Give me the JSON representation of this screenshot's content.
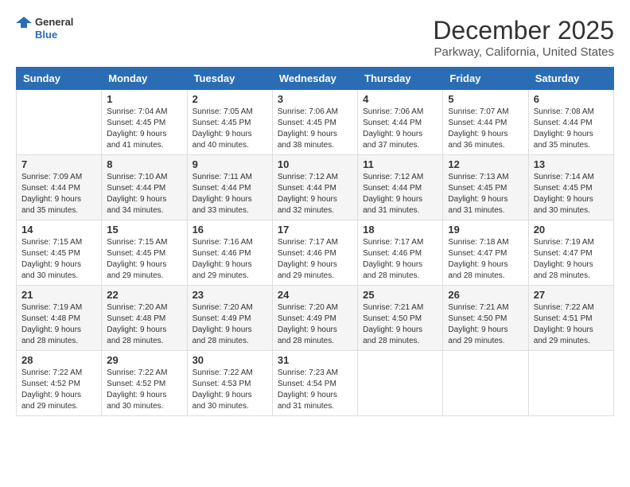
{
  "logo": {
    "general": "General",
    "blue": "Blue"
  },
  "title": "December 2025",
  "location": "Parkway, California, United States",
  "days_of_week": [
    "Sunday",
    "Monday",
    "Tuesday",
    "Wednesday",
    "Thursday",
    "Friday",
    "Saturday"
  ],
  "weeks": [
    [
      {
        "day": "",
        "sunrise": "",
        "sunset": "",
        "daylight": ""
      },
      {
        "day": "1",
        "sunrise": "Sunrise: 7:04 AM",
        "sunset": "Sunset: 4:45 PM",
        "daylight": "Daylight: 9 hours and 41 minutes."
      },
      {
        "day": "2",
        "sunrise": "Sunrise: 7:05 AM",
        "sunset": "Sunset: 4:45 PM",
        "daylight": "Daylight: 9 hours and 40 minutes."
      },
      {
        "day": "3",
        "sunrise": "Sunrise: 7:06 AM",
        "sunset": "Sunset: 4:45 PM",
        "daylight": "Daylight: 9 hours and 38 minutes."
      },
      {
        "day": "4",
        "sunrise": "Sunrise: 7:06 AM",
        "sunset": "Sunset: 4:44 PM",
        "daylight": "Daylight: 9 hours and 37 minutes."
      },
      {
        "day": "5",
        "sunrise": "Sunrise: 7:07 AM",
        "sunset": "Sunset: 4:44 PM",
        "daylight": "Daylight: 9 hours and 36 minutes."
      },
      {
        "day": "6",
        "sunrise": "Sunrise: 7:08 AM",
        "sunset": "Sunset: 4:44 PM",
        "daylight": "Daylight: 9 hours and 35 minutes."
      }
    ],
    [
      {
        "day": "7",
        "sunrise": "Sunrise: 7:09 AM",
        "sunset": "Sunset: 4:44 PM",
        "daylight": "Daylight: 9 hours and 35 minutes."
      },
      {
        "day": "8",
        "sunrise": "Sunrise: 7:10 AM",
        "sunset": "Sunset: 4:44 PM",
        "daylight": "Daylight: 9 hours and 34 minutes."
      },
      {
        "day": "9",
        "sunrise": "Sunrise: 7:11 AM",
        "sunset": "Sunset: 4:44 PM",
        "daylight": "Daylight: 9 hours and 33 minutes."
      },
      {
        "day": "10",
        "sunrise": "Sunrise: 7:12 AM",
        "sunset": "Sunset: 4:44 PM",
        "daylight": "Daylight: 9 hours and 32 minutes."
      },
      {
        "day": "11",
        "sunrise": "Sunrise: 7:12 AM",
        "sunset": "Sunset: 4:44 PM",
        "daylight": "Daylight: 9 hours and 31 minutes."
      },
      {
        "day": "12",
        "sunrise": "Sunrise: 7:13 AM",
        "sunset": "Sunset: 4:45 PM",
        "daylight": "Daylight: 9 hours and 31 minutes."
      },
      {
        "day": "13",
        "sunrise": "Sunrise: 7:14 AM",
        "sunset": "Sunset: 4:45 PM",
        "daylight": "Daylight: 9 hours and 30 minutes."
      }
    ],
    [
      {
        "day": "14",
        "sunrise": "Sunrise: 7:15 AM",
        "sunset": "Sunset: 4:45 PM",
        "daylight": "Daylight: 9 hours and 30 minutes."
      },
      {
        "day": "15",
        "sunrise": "Sunrise: 7:15 AM",
        "sunset": "Sunset: 4:45 PM",
        "daylight": "Daylight: 9 hours and 29 minutes."
      },
      {
        "day": "16",
        "sunrise": "Sunrise: 7:16 AM",
        "sunset": "Sunset: 4:46 PM",
        "daylight": "Daylight: 9 hours and 29 minutes."
      },
      {
        "day": "17",
        "sunrise": "Sunrise: 7:17 AM",
        "sunset": "Sunset: 4:46 PM",
        "daylight": "Daylight: 9 hours and 29 minutes."
      },
      {
        "day": "18",
        "sunrise": "Sunrise: 7:17 AM",
        "sunset": "Sunset: 4:46 PM",
        "daylight": "Daylight: 9 hours and 28 minutes."
      },
      {
        "day": "19",
        "sunrise": "Sunrise: 7:18 AM",
        "sunset": "Sunset: 4:47 PM",
        "daylight": "Daylight: 9 hours and 28 minutes."
      },
      {
        "day": "20",
        "sunrise": "Sunrise: 7:19 AM",
        "sunset": "Sunset: 4:47 PM",
        "daylight": "Daylight: 9 hours and 28 minutes."
      }
    ],
    [
      {
        "day": "21",
        "sunrise": "Sunrise: 7:19 AM",
        "sunset": "Sunset: 4:48 PM",
        "daylight": "Daylight: 9 hours and 28 minutes."
      },
      {
        "day": "22",
        "sunrise": "Sunrise: 7:20 AM",
        "sunset": "Sunset: 4:48 PM",
        "daylight": "Daylight: 9 hours and 28 minutes."
      },
      {
        "day": "23",
        "sunrise": "Sunrise: 7:20 AM",
        "sunset": "Sunset: 4:49 PM",
        "daylight": "Daylight: 9 hours and 28 minutes."
      },
      {
        "day": "24",
        "sunrise": "Sunrise: 7:20 AM",
        "sunset": "Sunset: 4:49 PM",
        "daylight": "Daylight: 9 hours and 28 minutes."
      },
      {
        "day": "25",
        "sunrise": "Sunrise: 7:21 AM",
        "sunset": "Sunset: 4:50 PM",
        "daylight": "Daylight: 9 hours and 28 minutes."
      },
      {
        "day": "26",
        "sunrise": "Sunrise: 7:21 AM",
        "sunset": "Sunset: 4:50 PM",
        "daylight": "Daylight: 9 hours and 29 minutes."
      },
      {
        "day": "27",
        "sunrise": "Sunrise: 7:22 AM",
        "sunset": "Sunset: 4:51 PM",
        "daylight": "Daylight: 9 hours and 29 minutes."
      }
    ],
    [
      {
        "day": "28",
        "sunrise": "Sunrise: 7:22 AM",
        "sunset": "Sunset: 4:52 PM",
        "daylight": "Daylight: 9 hours and 29 minutes."
      },
      {
        "day": "29",
        "sunrise": "Sunrise: 7:22 AM",
        "sunset": "Sunset: 4:52 PM",
        "daylight": "Daylight: 9 hours and 30 minutes."
      },
      {
        "day": "30",
        "sunrise": "Sunrise: 7:22 AM",
        "sunset": "Sunset: 4:53 PM",
        "daylight": "Daylight: 9 hours and 30 minutes."
      },
      {
        "day": "31",
        "sunrise": "Sunrise: 7:23 AM",
        "sunset": "Sunset: 4:54 PM",
        "daylight": "Daylight: 9 hours and 31 minutes."
      },
      {
        "day": "",
        "sunrise": "",
        "sunset": "",
        "daylight": ""
      },
      {
        "day": "",
        "sunrise": "",
        "sunset": "",
        "daylight": ""
      },
      {
        "day": "",
        "sunrise": "",
        "sunset": "",
        "daylight": ""
      }
    ]
  ]
}
